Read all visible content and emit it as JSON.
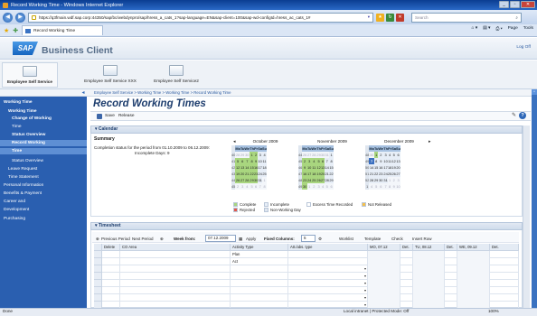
{
  "browser": {
    "window_title": "Record Working Time - Windows Internet Explorer",
    "url": "https://q3fmain.wdf.sap.corp:44350/sap/bc/webdynpro/sap/hress_a_cats_1?sap-language=EN&sap-client=100&sap-wd-configId=hress_ac_cats_1#",
    "search_placeholder": "Search",
    "tab_title": "Record Working Time",
    "tools": [
      "Page",
      "Tools"
    ],
    "status_left": "Done",
    "status_zone": "Local intranet | Protected Mode: Off",
    "status_zoom": "100%"
  },
  "sap": {
    "brand": "Business Client",
    "logo_text": "SAP",
    "logoff": "Log Off",
    "roles": [
      "Employee Self Service",
      "Employee Self Service XXX",
      "Employee Self Service2"
    ],
    "breadcrumb": "Employee Self Service > Working Time > Working Time > Record Working Time"
  },
  "nav": [
    {
      "label": "Working Time",
      "level": 1,
      "bold": true,
      "selected": false
    },
    {
      "label": "Working Time",
      "level": 2,
      "bold": true,
      "selected": false
    },
    {
      "label": "Change of Working",
      "level": 3,
      "bold": true,
      "selected": false
    },
    {
      "label": "Time",
      "level": 3,
      "bold": false,
      "selected": false
    },
    {
      "label": "Status Overview",
      "level": 3,
      "bold": true,
      "selected": false
    },
    {
      "label": "Record Working",
      "level": 3,
      "bold": true,
      "selected": true
    },
    {
      "label": "Time",
      "level": 3,
      "bold": false,
      "selected": true
    },
    {
      "label": "Status Overview",
      "level": 3,
      "bold": false,
      "selected": false
    },
    {
      "label": "Leave Request",
      "level": 2,
      "bold": false,
      "selected": false
    },
    {
      "label": "Time Statement",
      "level": 2,
      "bold": false,
      "selected": false
    },
    {
      "label": "Personal Information",
      "level": 1,
      "bold": false,
      "selected": false
    },
    {
      "label": "Benefits & Payment",
      "level": 1,
      "bold": false,
      "selected": false
    },
    {
      "label": "Career and",
      "level": 1,
      "bold": false,
      "selected": false
    },
    {
      "label": "Development",
      "level": 1,
      "bold": false,
      "selected": false
    },
    {
      "label": "Purchasing",
      "level": 1,
      "bold": false,
      "selected": false
    }
  ],
  "page": {
    "title": "Record Working Times",
    "save_label": "Save",
    "release_label": "Release",
    "calendar_section": "Calendar",
    "timesheet_section": "Timesheet"
  },
  "summary": {
    "title": "Summary",
    "line1": "Completion status for the period from 01.10.2009 to 06.12.2009:",
    "line2": "Incomplete Days:  9"
  },
  "calendar": {
    "weekday_headers": [
      "Mo",
      "Tu",
      "We",
      "Th",
      "Fr",
      "Sa",
      "Su"
    ],
    "months": [
      {
        "name": "October 2009",
        "weeks": [
          {
            "wk": "40",
            "days": [
              [
                "28",
                "o"
              ],
              [
                "29",
                "o"
              ],
              [
                "30",
                "o"
              ],
              [
                "1",
                "c"
              ],
              [
                "2",
                "c"
              ],
              [
                "3",
                "d"
              ],
              [
                "4",
                "d"
              ]
            ]
          },
          {
            "wk": "41",
            "days": [
              [
                "5",
                "c"
              ],
              [
                "6",
                "c"
              ],
              [
                "7",
                "c"
              ],
              [
                "8",
                "c"
              ],
              [
                "9",
                "c"
              ],
              [
                "10",
                "d"
              ],
              [
                "11",
                "d"
              ]
            ]
          },
          {
            "wk": "42",
            "days": [
              [
                "12",
                "c"
              ],
              [
                "13",
                "c"
              ],
              [
                "14",
                "c"
              ],
              [
                "15",
                "c"
              ],
              [
                "16",
                "c"
              ],
              [
                "17",
                "d"
              ],
              [
                "18",
                "d"
              ]
            ]
          },
          {
            "wk": "43",
            "days": [
              [
                "19",
                "c"
              ],
              [
                "20",
                "c"
              ],
              [
                "21",
                "c"
              ],
              [
                "22",
                "c"
              ],
              [
                "23",
                "c"
              ],
              [
                "24",
                "d"
              ],
              [
                "25",
                "d"
              ]
            ]
          },
          {
            "wk": "44",
            "days": [
              [
                "26",
                "c"
              ],
              [
                "27",
                "c"
              ],
              [
                "28",
                "c"
              ],
              [
                "29",
                "c"
              ],
              [
                "30",
                "c"
              ],
              [
                "31",
                "d"
              ],
              [
                "1",
                "o"
              ]
            ]
          },
          {
            "wk": "45",
            "days": [
              [
                "2",
                "o"
              ],
              [
                "3",
                "o"
              ],
              [
                "4",
                "o"
              ],
              [
                "5",
                "o"
              ],
              [
                "6",
                "o"
              ],
              [
                "7",
                "o"
              ],
              [
                "8",
                "o"
              ]
            ]
          }
        ]
      },
      {
        "name": "November 2009",
        "weeks": [
          {
            "wk": "44",
            "days": [
              [
                "26",
                "o"
              ],
              [
                "27",
                "o"
              ],
              [
                "28",
                "o"
              ],
              [
                "29",
                "o"
              ],
              [
                "30",
                "o"
              ],
              [
                "31",
                "o"
              ],
              [
                "1",
                "d"
              ]
            ]
          },
          {
            "wk": "45",
            "days": [
              [
                "2",
                "c"
              ],
              [
                "3",
                "c"
              ],
              [
                "4",
                "c"
              ],
              [
                "5",
                "c"
              ],
              [
                "6",
                "c"
              ],
              [
                "7",
                "d"
              ],
              [
                "8",
                "d"
              ]
            ]
          },
          {
            "wk": "46",
            "days": [
              [
                "9",
                "c"
              ],
              [
                "10",
                "c"
              ],
              [
                "11",
                "c"
              ],
              [
                "12",
                "c"
              ],
              [
                "13",
                "c"
              ],
              [
                "14",
                "d"
              ],
              [
                "15",
                "d"
              ]
            ]
          },
          {
            "wk": "47",
            "days": [
              [
                "16",
                "c"
              ],
              [
                "17",
                "c"
              ],
              [
                "18",
                "c"
              ],
              [
                "19",
                "c"
              ],
              [
                "20",
                "c"
              ],
              [
                "21",
                "d"
              ],
              [
                "22",
                "d"
              ]
            ]
          },
          {
            "wk": "48",
            "days": [
              [
                "23",
                "c"
              ],
              [
                "24",
                "c"
              ],
              [
                "25",
                "c"
              ],
              [
                "26",
                "c"
              ],
              [
                "27",
                "c"
              ],
              [
                "28",
                "d"
              ],
              [
                "29",
                "d"
              ]
            ]
          },
          {
            "wk": "49",
            "days": [
              [
                "30",
                "c"
              ],
              [
                "1",
                "o"
              ],
              [
                "2",
                "o"
              ],
              [
                "3",
                "o"
              ],
              [
                "4",
                "o"
              ],
              [
                "5",
                "o"
              ],
              [
                "6",
                "o"
              ]
            ]
          }
        ]
      },
      {
        "name": "December 2009",
        "weeks": [
          {
            "wk": "48",
            "days": [
              [
                "30",
                "o"
              ],
              [
                "1",
                "c"
              ],
              [
                "2",
                "d"
              ],
              [
                "3",
                "d"
              ],
              [
                "4",
                "d"
              ],
              [
                "5",
                "d"
              ],
              [
                "6",
                "d"
              ]
            ]
          },
          {
            "wk": "49",
            "days": [
              [
                "7",
                "t"
              ],
              [
                "8",
                "d"
              ],
              [
                "9",
                "d"
              ],
              [
                "10",
                "d"
              ],
              [
                "11",
                "d"
              ],
              [
                "12",
                "d"
              ],
              [
                "13",
                "d"
              ]
            ]
          },
          {
            "wk": "50",
            "days": [
              [
                "14",
                "d"
              ],
              [
                "15",
                "d"
              ],
              [
                "16",
                "d"
              ],
              [
                "17",
                "d"
              ],
              [
                "18",
                "d"
              ],
              [
                "19",
                "d"
              ],
              [
                "20",
                "d"
              ]
            ]
          },
          {
            "wk": "51",
            "days": [
              [
                "21",
                "d"
              ],
              [
                "22",
                "d"
              ],
              [
                "23",
                "d"
              ],
              [
                "24",
                "d"
              ],
              [
                "25",
                "d"
              ],
              [
                "26",
                "d"
              ],
              [
                "27",
                "d"
              ]
            ]
          },
          {
            "wk": "52",
            "days": [
              [
                "28",
                "d"
              ],
              [
                "29",
                "d"
              ],
              [
                "30",
                "d"
              ],
              [
                "31",
                "d"
              ],
              [
                "1",
                "o"
              ],
              [
                "2",
                "o"
              ],
              [
                "3",
                "o"
              ]
            ]
          },
          {
            "wk": "1",
            "days": [
              [
                "4",
                "o"
              ],
              [
                "5",
                "o"
              ],
              [
                "6",
                "o"
              ],
              [
                "7",
                "o"
              ],
              [
                "8",
                "o"
              ],
              [
                "9",
                "o"
              ],
              [
                "10",
                "o"
              ]
            ]
          }
        ]
      }
    ],
    "legend": [
      {
        "label": "Complete",
        "color": "#a9d67f"
      },
      {
        "label": "Incomplete",
        "color": "#e7eef7"
      },
      {
        "label": "Excess Time Recorded",
        "color": "#ffffff"
      },
      {
        "label": "Not Released",
        "color": "#f6c04a"
      },
      {
        "label": "Rejected",
        "color": "#e2574c"
      },
      {
        "label": "Non-Working Day",
        "color": "#dfe6ef"
      }
    ]
  },
  "timesheet": {
    "prev_period": "Previous Period",
    "next_period": "Next Period",
    "week_from_label": "Week from:",
    "week_from_value": "07.12.2009",
    "apply": "Apply",
    "fixed_columns_label": "Fixed Columns:",
    "fixed_columns_value": "5",
    "worklist": "Worklist",
    "template": "Template",
    "check": "Check",
    "insert_row": "Insert Row",
    "headers": [
      "Delete",
      "CO Area",
      "Activity Type",
      "Att./abs. type",
      "MO, 07.12",
      "Det.",
      "TU, 08.12",
      "Det.",
      "WE, 09.12",
      "Det."
    ],
    "sub_rows": [
      "Plan",
      "Act"
    ]
  }
}
